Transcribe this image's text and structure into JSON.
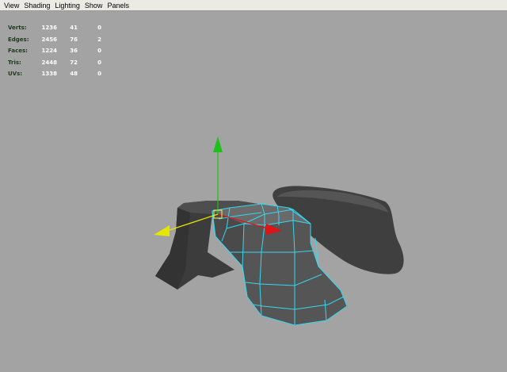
{
  "menu": {
    "items": [
      "View",
      "Shading",
      "Lighting",
      "Show",
      "Panels"
    ]
  },
  "hud": {
    "rows": [
      {
        "label": "Verts:",
        "total": "1236",
        "selected": "41",
        "components": "0"
      },
      {
        "label": "Edges:",
        "total": "2456",
        "selected": "76",
        "components": "2"
      },
      {
        "label": "Faces:",
        "total": "1224",
        "selected": "36",
        "components": "0"
      },
      {
        "label": "Tris:",
        "total": "2448",
        "selected": "72",
        "components": "0"
      },
      {
        "label": "UVs:",
        "total": "1338",
        "selected": "48",
        "components": "0"
      }
    ]
  },
  "colors": {
    "viewport_bg": "#a3a3a3",
    "wireframe": "#35d8f0",
    "axis_y": "#1ec01e",
    "axis_x": "#e01414",
    "axis_z": "#e6e600",
    "mesh_dark": "#3e3e3e"
  },
  "icons": {
    "manipulator": "move-manipulator-icon"
  }
}
